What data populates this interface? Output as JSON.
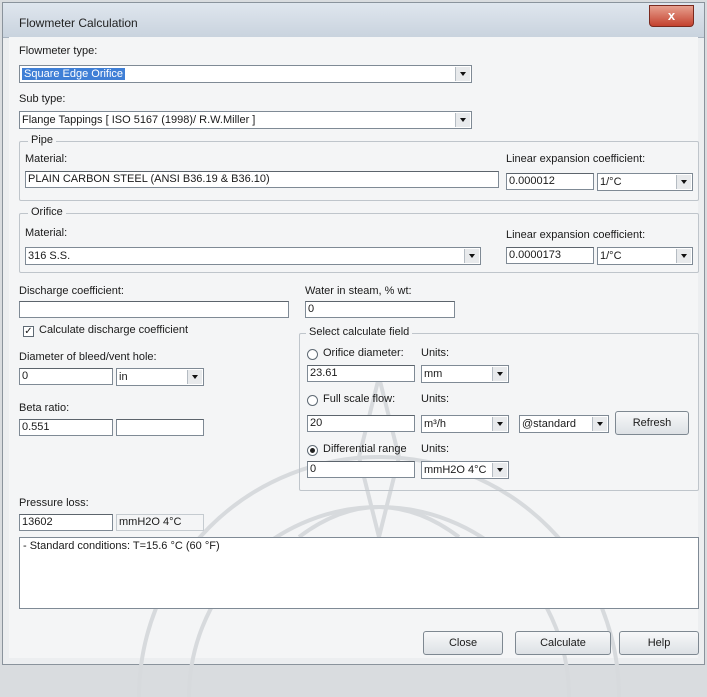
{
  "window": {
    "title": "Flowmeter Calculation",
    "close_glyph": "x"
  },
  "flowmeter_type": {
    "label": "Flowmeter type:",
    "value": "Square Edge Orifice"
  },
  "sub_type": {
    "label": "Sub type:",
    "value": "Flange Tappings [ ISO 5167 (1998)/ R.W.Miller ]"
  },
  "pipe": {
    "group_title": "Pipe",
    "material_label": "Material:",
    "material_value": "PLAIN CARBON STEEL (ANSI B36.19 & B36.10)",
    "lin_exp_label": "Linear expansion coefficient:",
    "lin_exp_value": "0.000012",
    "lin_exp_unit": "1/°C"
  },
  "orifice": {
    "group_title": "Orifice",
    "material_label": "Material:",
    "material_value": "316 S.S.",
    "lin_exp_label": "Linear expansion coefficient:",
    "lin_exp_value": "0.0000173",
    "lin_exp_unit": "1/°C"
  },
  "discharge": {
    "label": "Discharge coefficient:",
    "value": ""
  },
  "water_in_steam": {
    "label": "Water in steam, % wt:",
    "value": "0"
  },
  "calc_discharge": {
    "label": "Calculate discharge coefficient",
    "checked": true,
    "check_glyph": "✓"
  },
  "bleed_hole": {
    "label": "Diameter of bleed/vent hole:",
    "value": "0",
    "unit": "in"
  },
  "beta_ratio": {
    "label": "Beta ratio:",
    "value": "0.551",
    "value2": ""
  },
  "calc_field": {
    "group_title": "Select calculate field",
    "orifice_diameter": {
      "label": "Orifice diameter:",
      "units_label": "Units:",
      "value": "23.61",
      "unit": "mm",
      "selected": false
    },
    "full_scale_flow": {
      "label": "Full scale flow:",
      "units_label": "Units:",
      "value": "20",
      "unit": "m³/h",
      "condition": "@standard",
      "refresh_label": "Refresh",
      "selected": false
    },
    "differential_range": {
      "label": "Differential range",
      "units_label": "Units:",
      "value": "0",
      "unit": "mmH2O 4°C",
      "selected": true
    }
  },
  "pressure_loss": {
    "label": "Pressure loss:",
    "value": "13602",
    "unit": "mmH2O 4°C"
  },
  "notes": {
    "text": "- Standard conditions: T=15.6 °C (60 °F)"
  },
  "buttons": {
    "close": "Close",
    "calculate": "Calculate",
    "help": "Help"
  },
  "colors": {
    "selection": "#3f7fd6",
    "close_button": "#c4422f"
  }
}
